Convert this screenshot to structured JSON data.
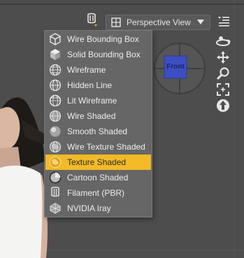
{
  "header": {
    "view_select_label": "Perspective View"
  },
  "nav_cube": {
    "face_label": "Front"
  },
  "draw_style_menu": {
    "items": [
      {
        "label": "Wire Bounding Box",
        "icon": "wire-box-icon"
      },
      {
        "label": "Solid Bounding Box",
        "icon": "solid-box-icon"
      },
      {
        "label": "Wireframe",
        "icon": "wireframe-sphere-icon"
      },
      {
        "label": "Hidden Line",
        "icon": "hidden-line-sphere-icon"
      },
      {
        "label": "Lit Wireframe",
        "icon": "lit-wireframe-sphere-icon"
      },
      {
        "label": "Wire Shaded",
        "icon": "wire-shaded-sphere-icon"
      },
      {
        "label": "Smooth Shaded",
        "icon": "smooth-shaded-sphere-icon"
      },
      {
        "label": "Wire Texture Shaded",
        "icon": "wire-texture-sphere-icon"
      },
      {
        "label": "Texture Shaded",
        "icon": "texture-shaded-sphere-icon"
      },
      {
        "label": "Cartoon Shaded",
        "icon": "cartoon-shaded-sphere-icon"
      },
      {
        "label": "Filament (PBR)",
        "icon": "filament-icon"
      },
      {
        "label": "NVIDIA Iray",
        "icon": "iray-icon"
      }
    ],
    "selected_label": "Texture Shaded"
  },
  "colors": {
    "accent": "#f3ba27",
    "menu_bg": "#666666",
    "viewport_bg": "#4d4d4d"
  }
}
